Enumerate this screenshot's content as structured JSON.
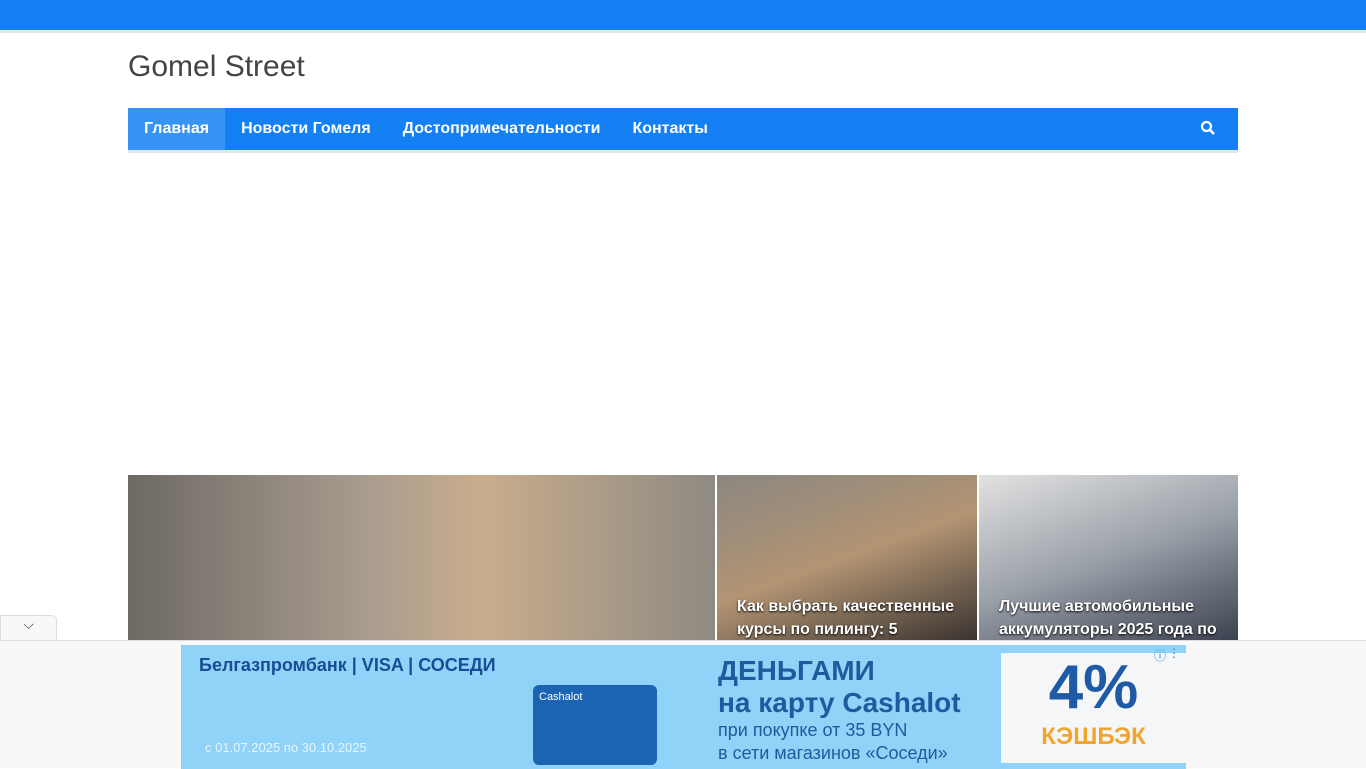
{
  "site": {
    "title": "Gomel Street"
  },
  "nav": {
    "items": [
      {
        "label": "Главная"
      },
      {
        "label": "Новости Гомеля"
      },
      {
        "label": "Достопримечательности"
      },
      {
        "label": "Контакты"
      }
    ]
  },
  "featured": [
    {
      "title": ""
    },
    {
      "title": "Как выбрать качественные курсы по пилингу: 5"
    },
    {
      "title": "Лучшие автомобильные аккумуляторы 2025 года по"
    }
  ],
  "ad": {
    "brand": "Белгазпромбанк | VISA | СОСЕДИ",
    "date": "с 01.07.2025 по 30.10.2025",
    "card": "Cashalot",
    "headline1": "ДЕНЬГАМИ",
    "headline2": "на карту Cashalot",
    "line1": "при покупке от 35 BYN",
    "line2": "в сети магазинов «Соседи»",
    "percent": "4%",
    "cashback": "КЭШБЭК"
  }
}
